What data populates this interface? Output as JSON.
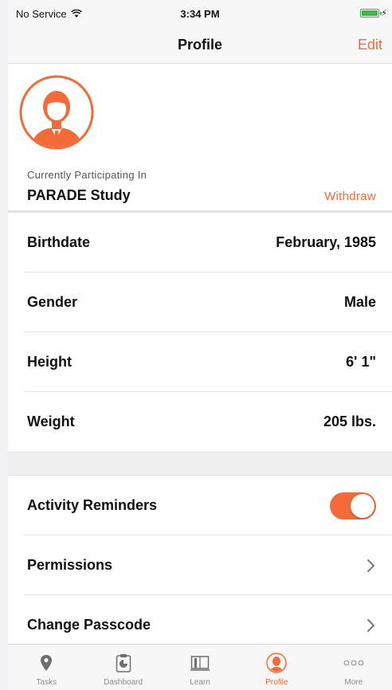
{
  "status_bar": {
    "carrier": "No Service",
    "time": "3:34 PM"
  },
  "nav": {
    "title": "Profile",
    "edit_label": "Edit"
  },
  "profile": {
    "participating_label": "Currently Participating In",
    "study_name": "PARADE Study",
    "withdraw_label": "Withdraw"
  },
  "details": [
    {
      "label": "Birthdate",
      "value": "February, 1985"
    },
    {
      "label": "Gender",
      "value": "Male"
    },
    {
      "label": "Height",
      "value": "6' 1\""
    },
    {
      "label": "Weight",
      "value": "205 lbs."
    }
  ],
  "settings": {
    "activity_reminders": {
      "label": "Activity Reminders",
      "enabled": true
    },
    "permissions": {
      "label": "Permissions"
    },
    "change_passcode": {
      "label": "Change Passcode"
    }
  },
  "tabs": [
    {
      "label": "Tasks",
      "icon": "map-pin-icon"
    },
    {
      "label": "Dashboard",
      "icon": "clipboard-chart-icon"
    },
    {
      "label": "Learn",
      "icon": "book-icon"
    },
    {
      "label": "Profile",
      "icon": "person-icon",
      "active": true
    },
    {
      "label": "More",
      "icon": "more-dots-icon"
    }
  ],
  "colors": {
    "accent": "#f26b38",
    "battery": "#3dbb44"
  }
}
